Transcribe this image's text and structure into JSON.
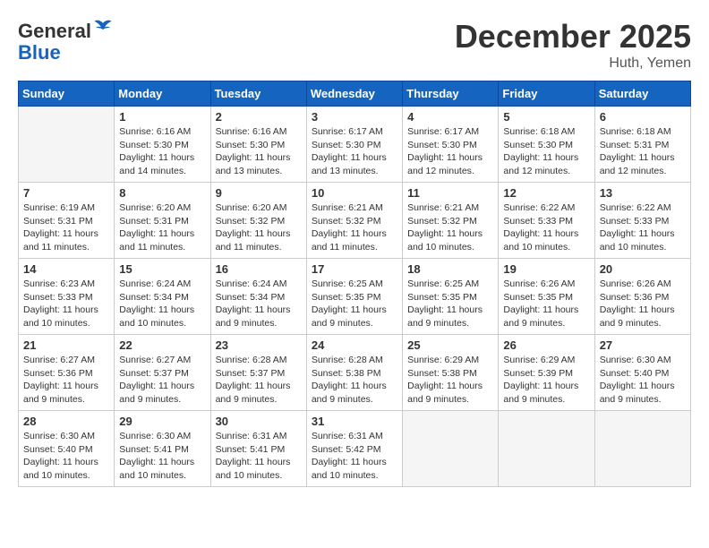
{
  "header": {
    "logo_line1": "General",
    "logo_line2": "Blue",
    "month": "December 2025",
    "location": "Huth, Yemen"
  },
  "weekdays": [
    "Sunday",
    "Monday",
    "Tuesday",
    "Wednesday",
    "Thursday",
    "Friday",
    "Saturday"
  ],
  "weeks": [
    [
      {
        "day": "",
        "info": ""
      },
      {
        "day": "1",
        "info": "Sunrise: 6:16 AM\nSunset: 5:30 PM\nDaylight: 11 hours\nand 14 minutes."
      },
      {
        "day": "2",
        "info": "Sunrise: 6:16 AM\nSunset: 5:30 PM\nDaylight: 11 hours\nand 13 minutes."
      },
      {
        "day": "3",
        "info": "Sunrise: 6:17 AM\nSunset: 5:30 PM\nDaylight: 11 hours\nand 13 minutes."
      },
      {
        "day": "4",
        "info": "Sunrise: 6:17 AM\nSunset: 5:30 PM\nDaylight: 11 hours\nand 12 minutes."
      },
      {
        "day": "5",
        "info": "Sunrise: 6:18 AM\nSunset: 5:30 PM\nDaylight: 11 hours\nand 12 minutes."
      },
      {
        "day": "6",
        "info": "Sunrise: 6:18 AM\nSunset: 5:31 PM\nDaylight: 11 hours\nand 12 minutes."
      }
    ],
    [
      {
        "day": "7",
        "info": "Sunrise: 6:19 AM\nSunset: 5:31 PM\nDaylight: 11 hours\nand 11 minutes."
      },
      {
        "day": "8",
        "info": "Sunrise: 6:20 AM\nSunset: 5:31 PM\nDaylight: 11 hours\nand 11 minutes."
      },
      {
        "day": "9",
        "info": "Sunrise: 6:20 AM\nSunset: 5:32 PM\nDaylight: 11 hours\nand 11 minutes."
      },
      {
        "day": "10",
        "info": "Sunrise: 6:21 AM\nSunset: 5:32 PM\nDaylight: 11 hours\nand 11 minutes."
      },
      {
        "day": "11",
        "info": "Sunrise: 6:21 AM\nSunset: 5:32 PM\nDaylight: 11 hours\nand 10 minutes."
      },
      {
        "day": "12",
        "info": "Sunrise: 6:22 AM\nSunset: 5:33 PM\nDaylight: 11 hours\nand 10 minutes."
      },
      {
        "day": "13",
        "info": "Sunrise: 6:22 AM\nSunset: 5:33 PM\nDaylight: 11 hours\nand 10 minutes."
      }
    ],
    [
      {
        "day": "14",
        "info": "Sunrise: 6:23 AM\nSunset: 5:33 PM\nDaylight: 11 hours\nand 10 minutes."
      },
      {
        "day": "15",
        "info": "Sunrise: 6:24 AM\nSunset: 5:34 PM\nDaylight: 11 hours\nand 10 minutes."
      },
      {
        "day": "16",
        "info": "Sunrise: 6:24 AM\nSunset: 5:34 PM\nDaylight: 11 hours\nand 9 minutes."
      },
      {
        "day": "17",
        "info": "Sunrise: 6:25 AM\nSunset: 5:35 PM\nDaylight: 11 hours\nand 9 minutes."
      },
      {
        "day": "18",
        "info": "Sunrise: 6:25 AM\nSunset: 5:35 PM\nDaylight: 11 hours\nand 9 minutes."
      },
      {
        "day": "19",
        "info": "Sunrise: 6:26 AM\nSunset: 5:35 PM\nDaylight: 11 hours\nand 9 minutes."
      },
      {
        "day": "20",
        "info": "Sunrise: 6:26 AM\nSunset: 5:36 PM\nDaylight: 11 hours\nand 9 minutes."
      }
    ],
    [
      {
        "day": "21",
        "info": "Sunrise: 6:27 AM\nSunset: 5:36 PM\nDaylight: 11 hours\nand 9 minutes."
      },
      {
        "day": "22",
        "info": "Sunrise: 6:27 AM\nSunset: 5:37 PM\nDaylight: 11 hours\nand 9 minutes."
      },
      {
        "day": "23",
        "info": "Sunrise: 6:28 AM\nSunset: 5:37 PM\nDaylight: 11 hours\nand 9 minutes."
      },
      {
        "day": "24",
        "info": "Sunrise: 6:28 AM\nSunset: 5:38 PM\nDaylight: 11 hours\nand 9 minutes."
      },
      {
        "day": "25",
        "info": "Sunrise: 6:29 AM\nSunset: 5:38 PM\nDaylight: 11 hours\nand 9 minutes."
      },
      {
        "day": "26",
        "info": "Sunrise: 6:29 AM\nSunset: 5:39 PM\nDaylight: 11 hours\nand 9 minutes."
      },
      {
        "day": "27",
        "info": "Sunrise: 6:30 AM\nSunset: 5:40 PM\nDaylight: 11 hours\nand 9 minutes."
      }
    ],
    [
      {
        "day": "28",
        "info": "Sunrise: 6:30 AM\nSunset: 5:40 PM\nDaylight: 11 hours\nand 10 minutes."
      },
      {
        "day": "29",
        "info": "Sunrise: 6:30 AM\nSunset: 5:41 PM\nDaylight: 11 hours\nand 10 minutes."
      },
      {
        "day": "30",
        "info": "Sunrise: 6:31 AM\nSunset: 5:41 PM\nDaylight: 11 hours\nand 10 minutes."
      },
      {
        "day": "31",
        "info": "Sunrise: 6:31 AM\nSunset: 5:42 PM\nDaylight: 11 hours\nand 10 minutes."
      },
      {
        "day": "",
        "info": ""
      },
      {
        "day": "",
        "info": ""
      },
      {
        "day": "",
        "info": ""
      }
    ]
  ]
}
